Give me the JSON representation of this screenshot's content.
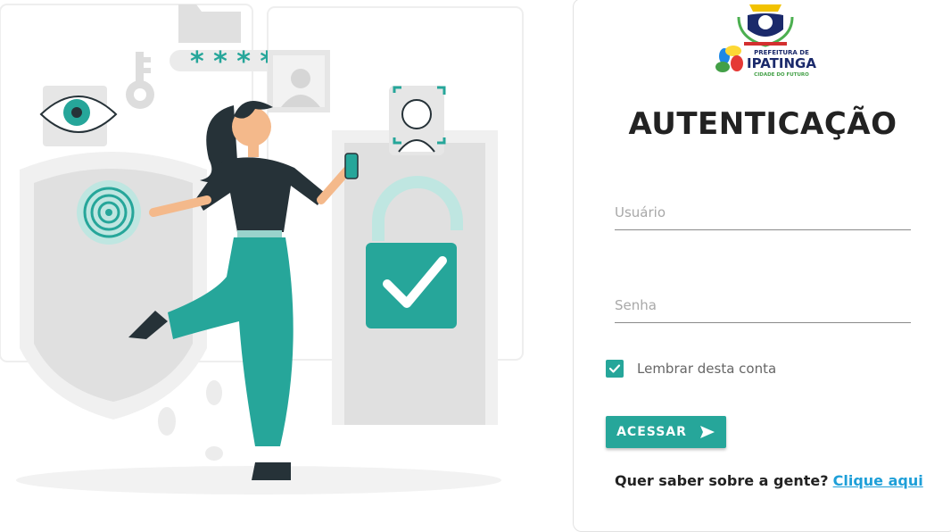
{
  "logo": {
    "org_prefix": "PREFEITURA DE",
    "org_name": "IPATINGA",
    "org_tagline": "CIDADE DO FUTURO"
  },
  "login": {
    "title": "AUTENTICAÇÃO",
    "username_placeholder": "Usuário",
    "password_placeholder": "Senha",
    "remember_label": "Lembrar desta conta",
    "remember_checked": true,
    "submit_label": "ACESSAR",
    "about_question": "Quer saber sobre a gente?",
    "about_link": "Clique aqui"
  },
  "colors": {
    "accent": "#26a69a",
    "link": "#1e9fd8"
  },
  "illustration": {
    "password_mask": "* * * *"
  }
}
